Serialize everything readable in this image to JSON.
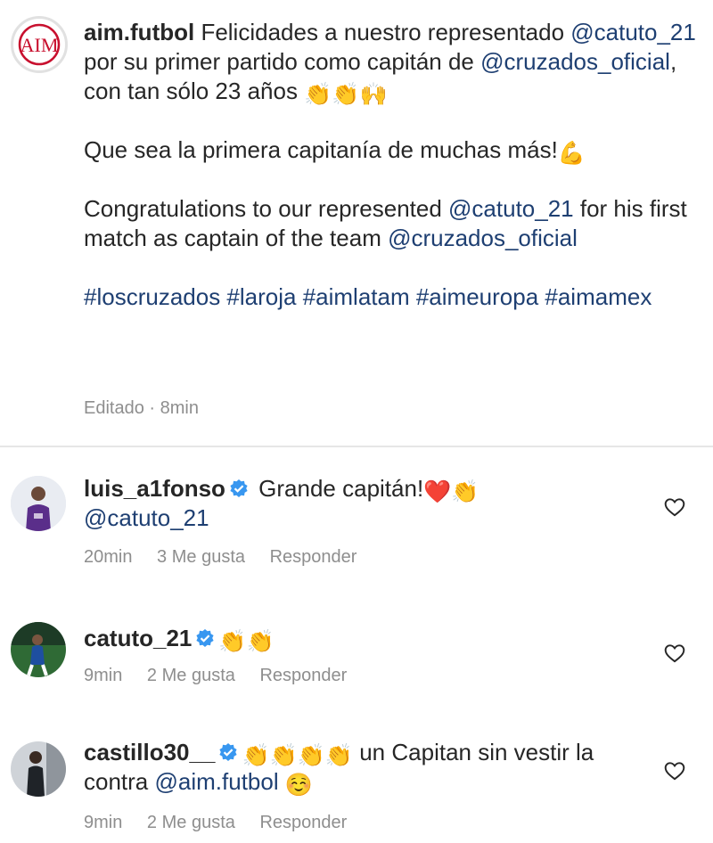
{
  "post": {
    "username": "aim.futbol",
    "text_1a": " Felicidades a nuestro representado ",
    "mention_1": "@catuto_21",
    "text_1b": " por su primer partido como capitán de ",
    "mention_2": "@cruzados_oficial",
    "text_1c": ", con tan sólo 23 años ",
    "para_2": "Que sea la primera capitanía de muchas más!",
    "text_3a": "Congratulations to our represented ",
    "mention_3": "@catuto_21",
    "text_3b": " for his first match as captain of the team ",
    "mention_4": "@cruzados_oficial",
    "hashtags": "#loscruzados #laroja #aimlatam #aimeuropa #aimamex",
    "meta": "Editado · 8min",
    "logo_text": "AIM"
  },
  "comments": [
    {
      "username": "luis_a1fonso",
      "text": " Grande capitán!",
      "mention": "@catuto_21",
      "time": "20min",
      "likes": "3 Me gusta",
      "reply": "Responder"
    },
    {
      "username": "catuto_21",
      "text": "",
      "time": "9min",
      "likes": "2 Me gusta",
      "reply": "Responder"
    },
    {
      "username": "castillo30__",
      "text_a": " un Capitan sin vestir la contra ",
      "mention": "@aim.futbol",
      "time": "9min",
      "likes": "2 Me gusta",
      "reply": "Responder"
    }
  ],
  "colors": {
    "mention": "#1e3f72",
    "meta": "#8e8e8e",
    "verified": "#3897f0",
    "logo": "#c8102e"
  },
  "icons": {
    "verified": "verified-badge-icon",
    "like": "heart-outline-icon"
  }
}
